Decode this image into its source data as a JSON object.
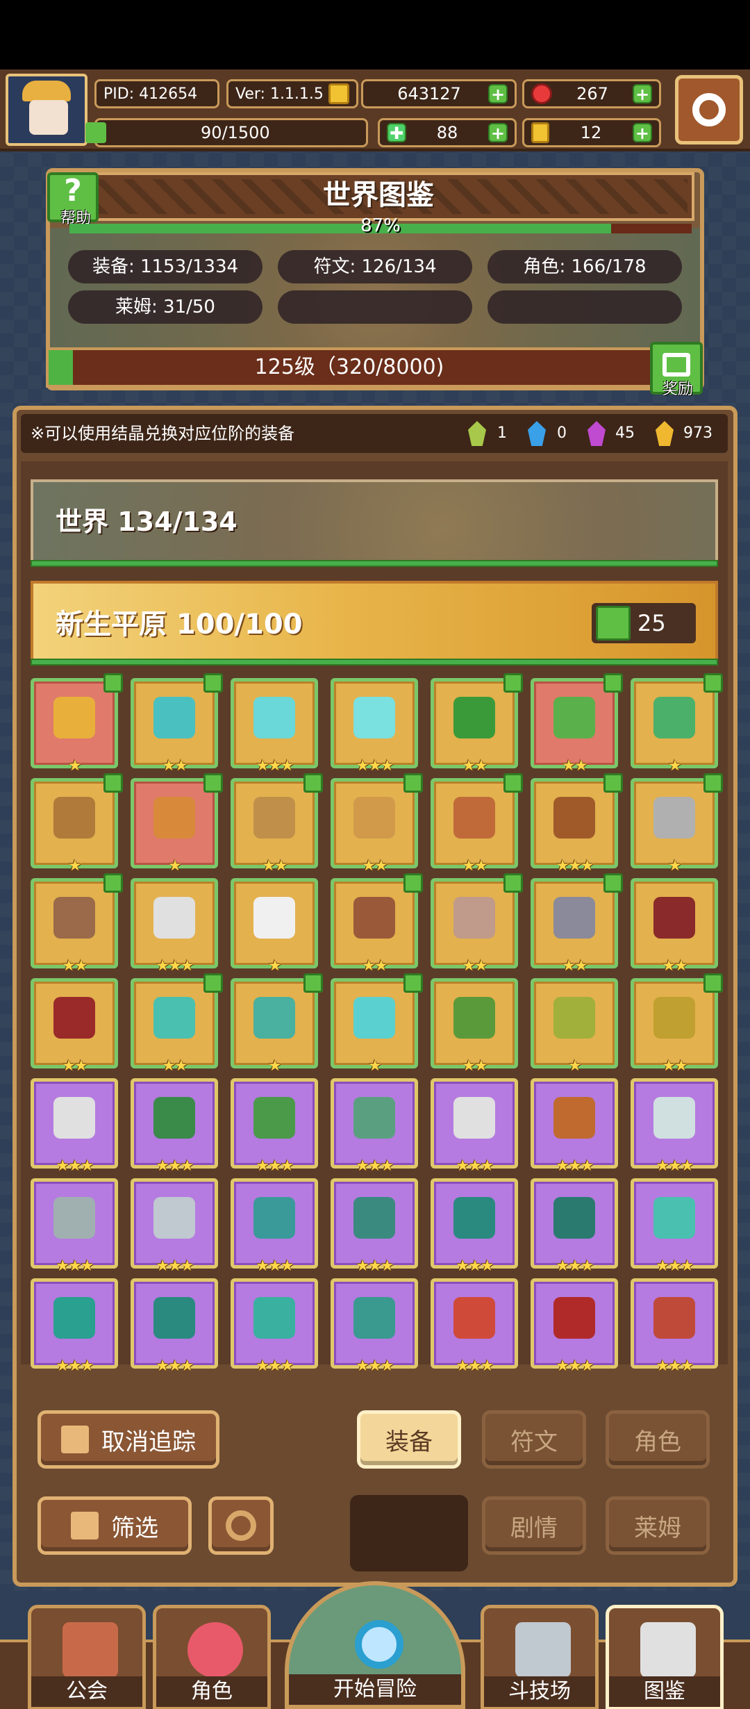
{
  "hud": {
    "pid": "PID: 412654",
    "version": "Ver: 1.1.1.5",
    "gold": "643127",
    "gems": "267",
    "stamina": "90/1500",
    "clover": "88",
    "keys": "12"
  },
  "codex": {
    "help_label": "帮助",
    "title": "世界图鉴",
    "percent": "87%",
    "percent_value": 0.87,
    "stats": [
      "装备: 1153/1334",
      "符文: 126/134",
      "角色: 166/178",
      "莱姆: 31/50"
    ],
    "level_text": "125级（320/8000)",
    "level_progress": 0.04,
    "reward_label": "奖励"
  },
  "hint": {
    "text": "※可以使用结晶兑换对应位阶的装备",
    "crystals": [
      {
        "color": "#a7c84a",
        "count": "1"
      },
      {
        "color": "#3aa0e8",
        "count": "0"
      },
      {
        "color": "#c04ad0",
        "count": "45"
      },
      {
        "color": "#f0b830",
        "count": "973"
      }
    ]
  },
  "world": {
    "label": "世界 134/134"
  },
  "region": {
    "label": "新生平原 100/100",
    "tracked_count": "25"
  },
  "grid": {
    "rows": [
      [
        {
          "bg": "red",
          "c": "#e8b03a",
          "s": "★",
          "t": 1
        },
        {
          "bg": "gold",
          "c": "#4ac0c0",
          "s": "★★",
          "t": 1
        },
        {
          "bg": "gold",
          "c": "#6ad8d8",
          "s": "★★★",
          "t": 0
        },
        {
          "bg": "gold",
          "c": "#7ae0e0",
          "s": "★★★",
          "t": 0
        },
        {
          "bg": "gold",
          "c": "#3a9a3a",
          "s": "★★",
          "t": 1
        },
        {
          "bg": "red",
          "c": "#5ab04a",
          "s": "★★",
          "t": 1
        },
        {
          "bg": "gold",
          "c": "#4ab06a",
          "s": "★",
          "t": 1
        }
      ],
      [
        {
          "bg": "gold",
          "c": "#b07a3a",
          "s": "★",
          "t": 1
        },
        {
          "bg": "red",
          "c": "#d88a3a",
          "s": "★",
          "t": 1
        },
        {
          "bg": "gold",
          "c": "#c0904a",
          "s": "★★",
          "t": 1
        },
        {
          "bg": "gold",
          "c": "#d09a4a",
          "s": "★★",
          "t": 1
        },
        {
          "bg": "gold",
          "c": "#c06a3a",
          "s": "★★",
          "t": 1
        },
        {
          "bg": "gold",
          "c": "#a05a2a",
          "s": "★★★",
          "t": 1
        },
        {
          "bg": "gold",
          "c": "#b0b0b0",
          "s": "★",
          "t": 1
        }
      ],
      [
        {
          "bg": "gold",
          "c": "#9a6a4a",
          "s": "★★",
          "t": 1
        },
        {
          "bg": "gold",
          "c": "#e0e0e0",
          "s": "★★★",
          "t": 0
        },
        {
          "bg": "gold",
          "c": "#f0f0f0",
          "s": "★",
          "t": 0
        },
        {
          "bg": "gold",
          "c": "#9a5a3a",
          "s": "★★",
          "t": 1
        },
        {
          "bg": "gold",
          "c": "#c09a8a",
          "s": "★★",
          "t": 1
        },
        {
          "bg": "gold",
          "c": "#8a8a9a",
          "s": "★★",
          "t": 1
        },
        {
          "bg": "gold",
          "c": "#8a2a2a",
          "s": "★★",
          "t": 0
        }
      ],
      [
        {
          "bg": "gold",
          "c": "#9a2a2a",
          "s": "★★",
          "t": 0
        },
        {
          "bg": "gold",
          "c": "#4ac0b0",
          "s": "★★",
          "t": 1
        },
        {
          "bg": "gold",
          "c": "#4ab0a0",
          "s": "★",
          "t": 1
        },
        {
          "bg": "gold",
          "c": "#5ad0d0",
          "s": "★",
          "t": 1
        },
        {
          "bg": "gold",
          "c": "#5a9a3a",
          "s": "★★",
          "t": 0
        },
        {
          "bg": "gold",
          "c": "#a0b03a",
          "s": "★",
          "t": 0
        },
        {
          "bg": "gold",
          "c": "#c0a030",
          "s": "★★",
          "t": 1
        }
      ],
      [
        {
          "bg": "purple",
          "c": "#e0e0e0",
          "s": "★★★",
          "t": 0
        },
        {
          "bg": "purple",
          "c": "#3a8a4a",
          "s": "★★★",
          "t": 0
        },
        {
          "bg": "purple",
          "c": "#4a9a4a",
          "s": "★★★",
          "t": 0
        },
        {
          "bg": "purple",
          "c": "#5aa080",
          "s": "★★★",
          "t": 0
        },
        {
          "bg": "purple",
          "c": "#e0e0e0",
          "s": "★★★",
          "t": 0
        },
        {
          "bg": "purple",
          "c": "#c06a30",
          "s": "★★★",
          "t": 0
        },
        {
          "bg": "purple",
          "c": "#d0e0e0",
          "s": "★★★",
          "t": 0
        }
      ],
      [
        {
          "bg": "purple",
          "c": "#a0b0b0",
          "s": "★★★",
          "t": 0
        },
        {
          "bg": "purple",
          "c": "#c0c8d0",
          "s": "★★★",
          "t": 0
        },
        {
          "bg": "purple",
          "c": "#3a9a9a",
          "s": "★★★",
          "t": 0
        },
        {
          "bg": "purple",
          "c": "#3a8a80",
          "s": "★★★",
          "t": 0
        },
        {
          "bg": "purple",
          "c": "#2a8a80",
          "s": "★★★",
          "t": 0
        },
        {
          "bg": "purple",
          "c": "#2a7a70",
          "s": "★★★",
          "t": 0
        },
        {
          "bg": "purple",
          "c": "#4ac0b0",
          "s": "★★★",
          "t": 0
        }
      ],
      [
        {
          "bg": "purple",
          "c": "#2aa090",
          "s": "★★★",
          "t": 0
        },
        {
          "bg": "purple",
          "c": "#2a8a80",
          "s": "★★★",
          "t": 0
        },
        {
          "bg": "purple",
          "c": "#3ab0a0",
          "s": "★★★",
          "t": 0
        },
        {
          "bg": "purple",
          "c": "#3a9a90",
          "s": "★★★",
          "t": 0
        },
        {
          "bg": "purple",
          "c": "#d04a3a",
          "s": "★★★",
          "t": 0
        },
        {
          "bg": "purple",
          "c": "#b02a2a",
          "s": "★★★",
          "t": 0
        },
        {
          "bg": "purple",
          "c": "#c04a3a",
          "s": "★★★",
          "t": 0
        }
      ]
    ]
  },
  "controls": {
    "untrack": "取消追踪",
    "filter": "筛选",
    "tab_equipment": "装备",
    "tab_rune": "符文",
    "tab_character": "角色",
    "tab_story": "剧情",
    "tab_slime": "莱姆"
  },
  "nav": {
    "guild": "公会",
    "character": "角色",
    "adventure": "开始冒险",
    "arena": "斗技场",
    "codex": "图鉴"
  }
}
